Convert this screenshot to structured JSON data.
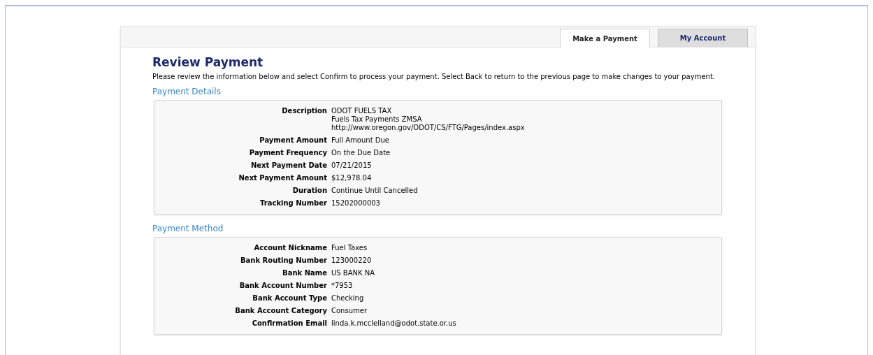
{
  "tabs": [
    {
      "label": "Make a Payment",
      "selected": true
    },
    {
      "label": "My Account",
      "selected": false
    }
  ],
  "title": "Review Payment",
  "intro": "Please review the information below and select Confirm to process your payment. Select Back to return to the previous page to make changes to your payment.",
  "sections": [
    {
      "heading": "Payment Details",
      "fields": [
        {
          "label": "Description",
          "value": [
            "ODOT FUELS TAX",
            "Fuels Tax Payments ZMSA",
            "http://www.oregon.gov/ODOT/CS/FTG/Pages/index.aspx"
          ]
        },
        {
          "label": "Payment Amount",
          "value": [
            "Full Amount Due"
          ]
        },
        {
          "label": "Payment Frequency",
          "value": [
            "On the Due Date"
          ]
        },
        {
          "label": "Next Payment Date",
          "value": [
            "07/21/2015"
          ]
        },
        {
          "label": "Next Payment Amount",
          "value": [
            "$12,978.04"
          ]
        },
        {
          "label": "Duration",
          "value": [
            "Continue Until Cancelled"
          ]
        },
        {
          "label": "Tracking Number",
          "value": [
            "15202000003"
          ]
        }
      ]
    },
    {
      "heading": "Payment Method",
      "fields": [
        {
          "label": "Account Nickname",
          "value": [
            "Fuel Taxes"
          ]
        },
        {
          "label": "Bank Routing Number",
          "value": [
            "123000220"
          ]
        },
        {
          "label": "Bank Name",
          "value": [
            "US BANK NA"
          ]
        },
        {
          "label": "Bank Account Number",
          "value": [
            "*7953"
          ]
        },
        {
          "label": "Bank Account Type",
          "value": [
            "Checking"
          ]
        },
        {
          "label": "Bank Account Category",
          "value": [
            "Consumer"
          ]
        },
        {
          "label": "Confirmation Email",
          "value": [
            "linda.k.mcclelland@odot.state.or.us"
          ]
        }
      ]
    }
  ]
}
